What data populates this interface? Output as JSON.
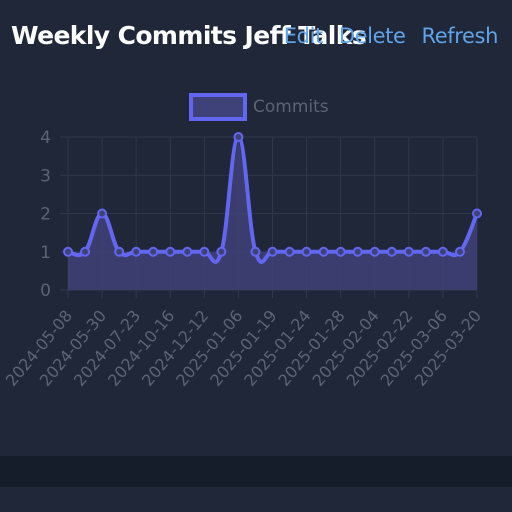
{
  "header": {
    "title": "Weekly Commits Jeff Talks",
    "actions": {
      "edit_label": "Edit",
      "delete_label": "Delete",
      "refresh_label": "Refresh"
    }
  },
  "colors": {
    "background": "#1f2738",
    "line": "#6366f1",
    "fill": "#3f4278",
    "link": "#5fa3e8",
    "grid": "#2f3849",
    "tick_text": "#5c6474",
    "legend_text": "#5c6474",
    "footer": "#151d2b"
  },
  "chart_data": {
    "type": "area",
    "legend_position": "top",
    "grid": true,
    "ylim": [
      0,
      4
    ],
    "y_ticks": [
      "0",
      "1",
      "2",
      "3",
      "4"
    ],
    "x_tick_labels": [
      "2024-05-08",
      "2024-05-30",
      "2024-07-23",
      "2024-10-16",
      "2024-12-12",
      "2025-01-06",
      "2025-01-19",
      "2025-01-24",
      "2025-01-28",
      "2025-02-04",
      "2025-02-22",
      "2025-03-06",
      "2025-03-20"
    ],
    "series": [
      {
        "name": "Commits",
        "values": [
          1,
          1,
          2,
          1,
          1,
          1,
          1,
          1,
          1,
          1,
          4,
          1,
          1,
          1,
          1,
          1,
          1,
          1,
          1,
          1,
          1,
          1,
          1,
          1,
          2
        ]
      }
    ]
  }
}
